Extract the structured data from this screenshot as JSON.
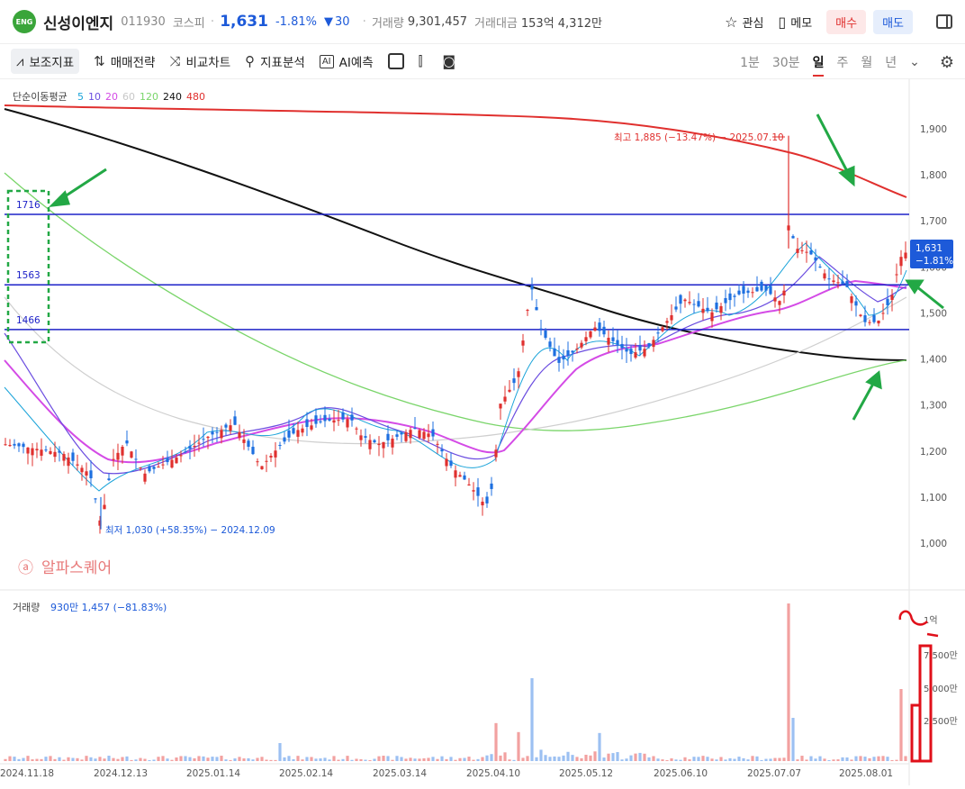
{
  "header": {
    "name": "신성이엔지",
    "code": "011930",
    "market": "코스피",
    "price": "1,631",
    "change_pct": "-1.81%",
    "change_abs": "30",
    "volume_label": "거래량",
    "volume": "9,301,457",
    "amount_label": "거래대금",
    "amount": "153억 4,312만",
    "watch_label": "관심",
    "memo_label": "메모",
    "buy_label": "매수",
    "sell_label": "매도"
  },
  "toolbar": {
    "indicator_label": "보조지표",
    "strategy_label": "매매전략",
    "compare_label": "비교차트",
    "analysis_label": "지표분석",
    "ai_label": "AI예측",
    "periods": [
      "1분",
      "30분",
      "일",
      "주",
      "월",
      "년"
    ],
    "selected_period": "일"
  },
  "chart_data": {
    "type": "candlestick",
    "ma_legend": {
      "title": "단순이동평균",
      "items": [
        "5",
        "10",
        "20",
        "60",
        "120",
        "240",
        "480"
      ],
      "colors": [
        "#1aa3d9",
        "#6b4de0",
        "#d44be6",
        "#c8c8c8",
        "#7ad56a",
        "#111111",
        "#e0302e"
      ]
    },
    "y_ticks": [
      "1,900",
      "1,800",
      "1,700",
      "1,600",
      "1,500",
      "1,400",
      "1,300",
      "1,200",
      "1,100",
      "1,000"
    ],
    "x_ticks": [
      "2024.11.18",
      "2024.12.13",
      "2025.01.14",
      "2025.02.14",
      "2025.03.14",
      "2025.04.10",
      "2025.05.12",
      "2025.06.10",
      "2025.07.07",
      "2025.08.01"
    ],
    "horizontal_lines": [
      1716,
      1563,
      1466
    ],
    "horizontal_line_labels": [
      "1716",
      "1563",
      "1466"
    ],
    "high_annotation": "최고 1,885 (−13.47%) − 2025.07.10",
    "low_annotation": "최저 1,030 (+58.35%) − 2024.12.09",
    "last_price": "1,631",
    "last_change": "−1.81%",
    "volume_label": "거래량",
    "volume_value": "930만 1,457 (−81.83%)",
    "volume_ticks": [
      "1억",
      "7,500만",
      "5,000만",
      "2,500만"
    ]
  },
  "watermark": "알파스퀘어"
}
